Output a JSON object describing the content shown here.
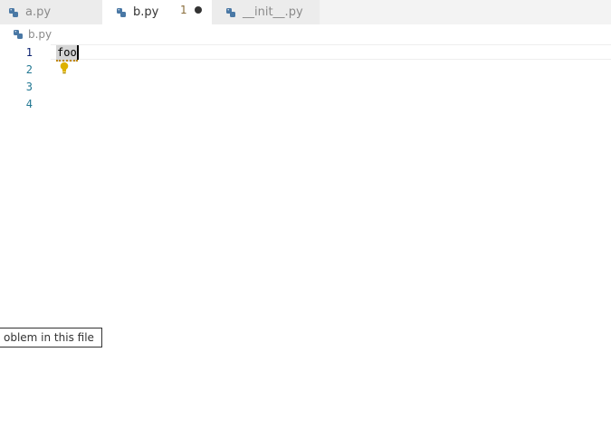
{
  "tabs": [
    {
      "label": "a.py",
      "active": false
    },
    {
      "label": "b.py",
      "active": true,
      "problems": "1",
      "dirty": true
    },
    {
      "label": "__init__.py",
      "active": false
    }
  ],
  "breadcrumb": {
    "file": "b.py"
  },
  "editor": {
    "line_numbers": [
      "1",
      "2",
      "3",
      "4"
    ],
    "current_line": "1",
    "code_line_1": "foo"
  },
  "tooltip": {
    "text": "oblem in this file"
  },
  "colors": {
    "python_icon_blue": "#4a78a5",
    "python_icon_yellow": "#d2a43a",
    "warning_squiggle": "#bf8803",
    "lightbulb": "#ddb100",
    "line_number": "#237893"
  },
  "icons": {
    "file_type": "python-file-icon",
    "quick_fix": "lightbulb-icon",
    "dirty_indicator": "dirty-dot-icon"
  }
}
